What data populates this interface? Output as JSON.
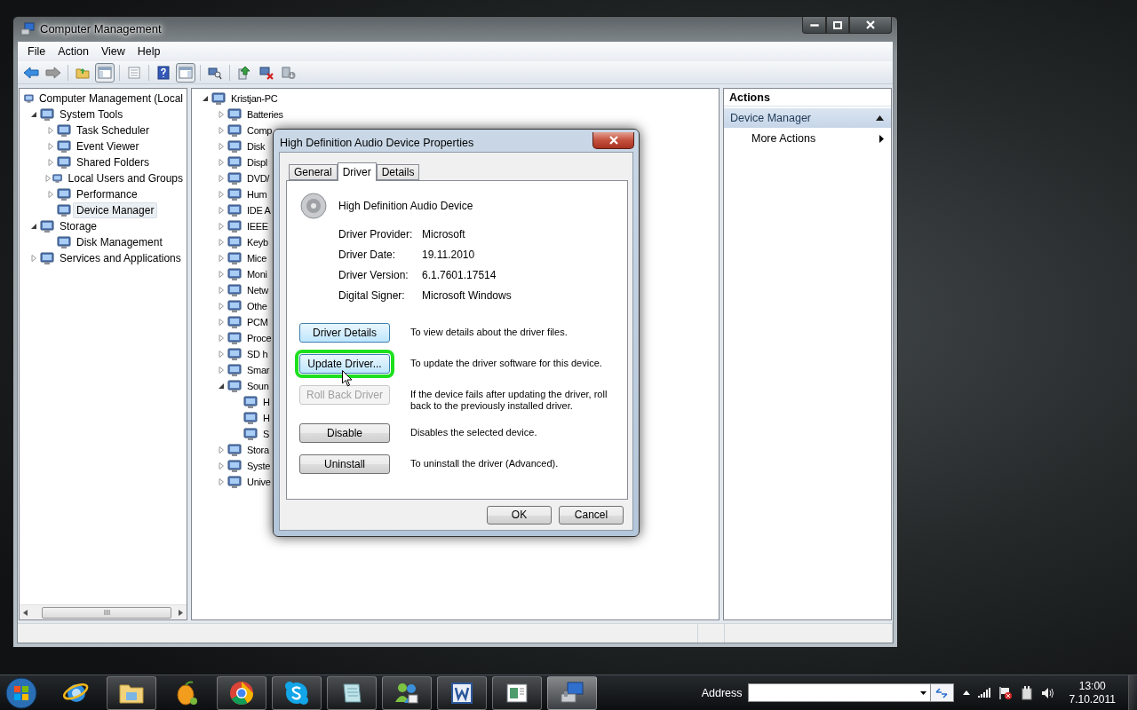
{
  "window": {
    "title": "Computer Management"
  },
  "menu": [
    "File",
    "Action",
    "View",
    "Help"
  ],
  "toolbar": [
    {
      "kind": "back",
      "pressed": false
    },
    {
      "kind": "forward",
      "pressed": false
    },
    {
      "kind": "sep"
    },
    {
      "kind": "up",
      "pressed": false
    },
    {
      "kind": "tree-pane",
      "pressed": true
    },
    {
      "kind": "sep"
    },
    {
      "kind": "list",
      "pressed": false
    },
    {
      "kind": "sep"
    },
    {
      "kind": "help",
      "pressed": false
    },
    {
      "kind": "action-pane",
      "pressed": true
    },
    {
      "kind": "sep"
    },
    {
      "kind": "scan",
      "pressed": false
    },
    {
      "kind": "sep"
    },
    {
      "kind": "update",
      "pressed": false
    },
    {
      "kind": "remove",
      "pressed": false
    },
    {
      "kind": "install",
      "pressed": false
    }
  ],
  "console_tree": [
    {
      "label": "Computer Management (Local",
      "selected": false,
      "children": [
        {
          "label": "System Tools",
          "expanded": true,
          "selected": false,
          "children": [
            {
              "label": "Task Scheduler",
              "expanded": false,
              "selected": false
            },
            {
              "label": "Event Viewer",
              "expanded": false,
              "selected": false
            },
            {
              "label": "Shared Folders",
              "expanded": false,
              "selected": false
            },
            {
              "label": "Local Users and Groups",
              "expanded": false,
              "selected": false
            },
            {
              "label": "Performance",
              "expanded": false,
              "selected": false
            },
            {
              "label": "Device Manager",
              "selected": true
            }
          ]
        },
        {
          "label": "Storage",
          "expanded": true,
          "selected": false,
          "children": [
            {
              "label": "Disk Management",
              "selected": false
            }
          ]
        },
        {
          "label": "Services and Applications",
          "expanded": false,
          "selected": false
        }
      ]
    }
  ],
  "device_tree": [
    {
      "label": "Kristjan-PC",
      "expanded": true,
      "children": [
        {
          "label": "Batteries",
          "expanded": false
        },
        {
          "label": "Comp",
          "expanded": false
        },
        {
          "label": "Disk",
          "expanded": false
        },
        {
          "label": "Displ",
          "expanded": false
        },
        {
          "label": "DVD/",
          "expanded": false
        },
        {
          "label": "Hum",
          "expanded": false
        },
        {
          "label": "IDE A",
          "expanded": false
        },
        {
          "label": "IEEE",
          "expanded": false
        },
        {
          "label": "Keyb",
          "expanded": false
        },
        {
          "label": "Mice",
          "expanded": false
        },
        {
          "label": "Moni",
          "expanded": false
        },
        {
          "label": "Netw",
          "expanded": false
        },
        {
          "label": "Othe",
          "expanded": false
        },
        {
          "label": "PCM",
          "expanded": false
        },
        {
          "label": "Proce",
          "expanded": false
        },
        {
          "label": "SD h",
          "expanded": false
        },
        {
          "label": "Smar",
          "expanded": false
        },
        {
          "label": "Soun",
          "expanded": true,
          "children": [
            {
              "label": "H"
            },
            {
              "label": "H"
            },
            {
              "label": "S"
            }
          ]
        },
        {
          "label": "Stora",
          "expanded": false
        },
        {
          "label": "Syste",
          "expanded": false
        },
        {
          "label": "Unive",
          "expanded": false
        }
      ]
    }
  ],
  "actions": {
    "title": "Actions",
    "section": {
      "label": "Device Manager",
      "expanded": true
    },
    "items": [
      "More Actions"
    ]
  },
  "dialog": {
    "title": "High Definition Audio Device Properties",
    "tabs": [
      {
        "label": "General",
        "selected": false
      },
      {
        "label": "Driver",
        "selected": true
      },
      {
        "label": "Details",
        "selected": false
      }
    ],
    "device_name": "High Definition Audio Device",
    "info": [
      {
        "label": "Driver Provider:",
        "value": "Microsoft"
      },
      {
        "label": "Driver Date:",
        "value": "19.11.2010"
      },
      {
        "label": "Driver Version:",
        "value": "6.1.7601.17514"
      },
      {
        "label": "Digital Signer:",
        "value": "Microsoft Windows"
      }
    ],
    "actions": [
      {
        "button": "Driver Details",
        "description": "To view details about the driver files.",
        "disabled": false,
        "hovered": true,
        "outlined": false
      },
      {
        "button": "Update Driver...",
        "description": "To update the driver software for this device.",
        "disabled": false,
        "hovered": true,
        "outlined": true
      },
      {
        "button": "Roll Back Driver",
        "description": "If the device fails after updating the driver, roll back to the previously installed driver.",
        "disabled": true,
        "hovered": false,
        "outlined": false
      },
      {
        "button": "Disable",
        "description": "Disables the selected device.",
        "disabled": false,
        "hovered": false,
        "outlined": false
      },
      {
        "button": "Uninstall",
        "description": "To uninstall the driver (Advanced).",
        "disabled": false,
        "hovered": false,
        "outlined": false
      }
    ],
    "buttons": [
      "OK",
      "Cancel"
    ]
  },
  "taskbar": {
    "apps": [
      {
        "kind": "ie",
        "running": false,
        "active": false
      },
      {
        "kind": "explorer",
        "running": true,
        "active": false
      },
      {
        "kind": "fl",
        "running": false,
        "active": false
      },
      {
        "kind": "chrome",
        "running": true,
        "active": false
      },
      {
        "kind": "skype",
        "running": true,
        "active": false
      },
      {
        "kind": "notes",
        "running": true,
        "active": false
      },
      {
        "kind": "messenger",
        "running": true,
        "active": false
      },
      {
        "kind": "word",
        "running": true,
        "active": false
      },
      {
        "kind": "document",
        "running": true,
        "active": false
      },
      {
        "kind": "compmgmt",
        "running": true,
        "active": true
      }
    ],
    "address_label": "Address",
    "time": "13:00",
    "date": "7.10.2011"
  }
}
